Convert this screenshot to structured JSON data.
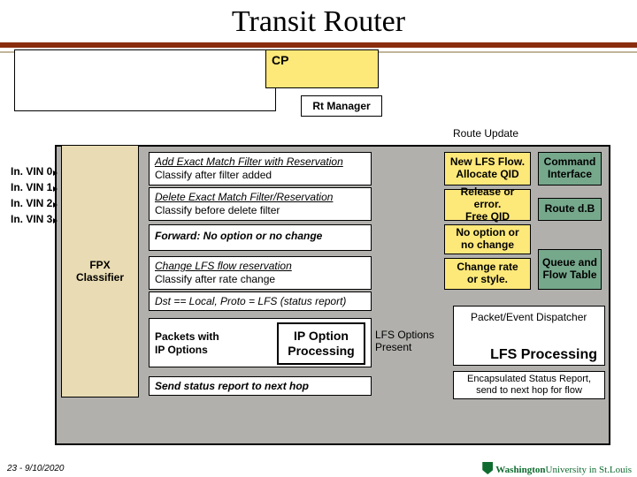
{
  "title": "Transit Router",
  "cp": "CP",
  "rt_manager": "Rt Manager",
  "route_update": "Route Update",
  "vlin": [
    "In. VIN 0",
    "In. VIN 1",
    "In. VIN 2",
    "In. VIN 3"
  ],
  "fpx": {
    "l1": "FPX",
    "l2": "Classifier"
  },
  "msg": {
    "add1": "Add Exact Match Filter with Reservation",
    "add2": "Classify after filter added",
    "del1": "Delete Exact Match Filter/Reservation",
    "del2": "Classify before delete filter",
    "fwd": "Forward: No option or no change",
    "chg1": "Change LFS flow reservation",
    "chg2": "Classify after rate change",
    "dst": "Dst == Local, Proto = LFS (status report)",
    "pkt1": "Packets with",
    "pkt2": "IP Options",
    "ipo1": "IP Option",
    "ipo2": "Processing",
    "lfsopt1": "LFS Options",
    "lfsopt2": "Present",
    "send": "Send status report to next hop"
  },
  "side": {
    "new1": "New LFS Flow.",
    "new2": "Allocate QID",
    "cmd1": "Command",
    "cmd2": "Interface",
    "rel1": "Release or error.",
    "rel2": "Free QID",
    "rdb": "Route d.B",
    "noop1": "No option or",
    "noop2": "no change",
    "rate1": "Change rate",
    "rate2": "or style.",
    "qft1": "Queue and",
    "qft2": "Flow Table",
    "ped": "Packet/Event Dispatcher",
    "lfs": "LFS Processing",
    "enc1": "Encapsulated Status Report,",
    "enc2": "send to next hop for flow"
  },
  "footer": {
    "page": "23 - 9/10/2020",
    "uni": "Washington University in St.Louis"
  }
}
